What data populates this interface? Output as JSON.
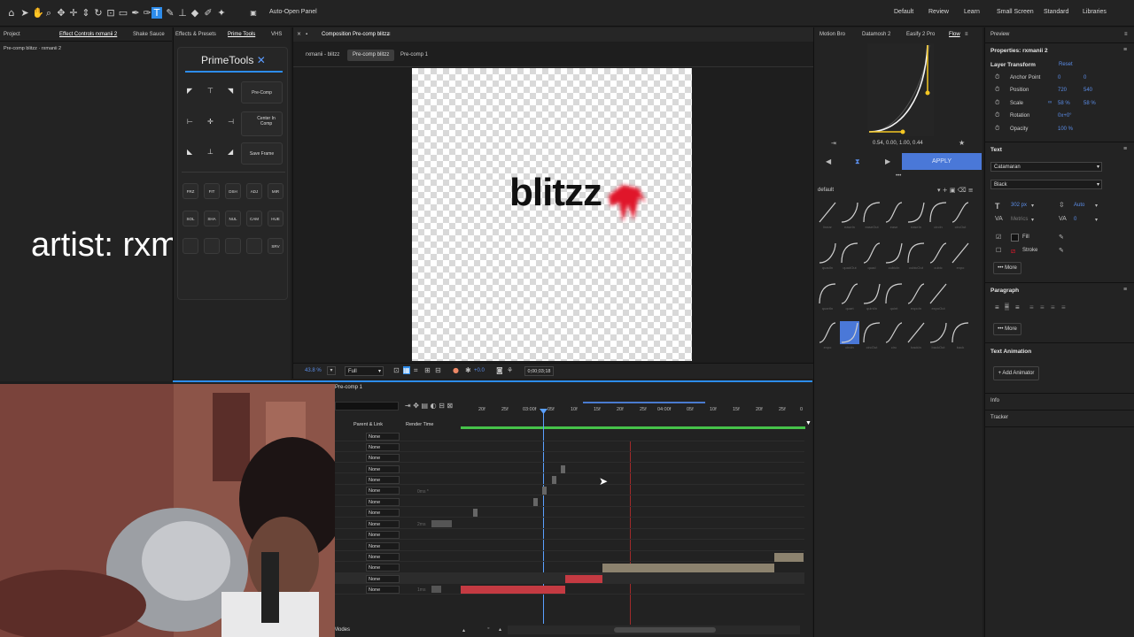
{
  "topbar": {
    "auto_open_panel": "Auto-Open Panel",
    "workspaces": [
      "Default",
      "Review",
      "Learn",
      "Small Screen",
      "Standard",
      "Libraries"
    ]
  },
  "left_panel": {
    "tabs": [
      "Project",
      "Effect Controls rxmanii 2"
    ],
    "subtitle": "Pre-comp blitzz · rxmanii 2",
    "overlay_text": "artist: rxmanii"
  },
  "primetools": {
    "tabs": [
      "Shake Sauce",
      "Effects & Presets",
      "Prime Tools",
      "VHS"
    ],
    "title": "PrimeTools",
    "buttons": [
      "Pre-Comp",
      "Center In Comp",
      "Save Frame"
    ],
    "small_row1": [
      "FRZ",
      "FIT",
      "DSH",
      "ADJ",
      "MIR"
    ],
    "small_row2": [
      "SOL",
      "SHA",
      "NUL",
      "CAM",
      "HUE"
    ],
    "small_row3": [
      "",
      "",
      "",
      "",
      "SRV"
    ]
  },
  "composition": {
    "tab_title": "Composition Pre-comp blitzz",
    "breadcrumbs": [
      "rxmanii - blitzz",
      "Pre-comp blitzz",
      "Pre-comp 1"
    ],
    "canvas_text": "blitzz",
    "zoom": "43.8 %",
    "resolution": "Full",
    "timecode": "0;00;03;18",
    "exposure": "+0.0"
  },
  "timeline": {
    "title": "Pre-comp 1",
    "col_parent": "Parent & Link",
    "col_render": "Render Time",
    "parent_value": "None",
    "ruler": [
      "20f",
      "25f",
      "03:00f",
      "05f",
      "10f",
      "15f",
      "20f",
      "25f",
      "04:00f",
      "05f",
      "10f",
      "15f",
      "20f",
      "25f",
      "0"
    ],
    "modes_label": "Modes",
    "render_labels": [
      "0ms *",
      "2ms",
      "1ms"
    ]
  },
  "flow": {
    "tabs": [
      "Motion Bro",
      "Datamosh 2",
      "Easify 2 Pro",
      "Flow"
    ],
    "curve_values": "0.54, 0.00, 1.00, 0.44",
    "apply_label": "APPLY",
    "preset_dropdown": "default",
    "ease_labels": [
      [
        "linear",
        "easeIn",
        "easeOut",
        "ease",
        "easeIn",
        "circIn",
        "circOut"
      ],
      [
        "quadIn",
        "quadOut",
        "quad",
        "cubicIn",
        "cubicOut",
        "cubic",
        "expo"
      ],
      [
        "quartIn",
        "quart",
        "quintIn",
        "quint",
        "expoIn",
        "expoOut"
      ],
      [
        "expo",
        "circIn",
        "circOut",
        "circ",
        "backIn",
        "backOut",
        "back"
      ]
    ]
  },
  "properties": {
    "preview_tab": "Preview",
    "title": "Properties: rxmanii 2",
    "layer_transform": "Layer Transform",
    "reset": "Reset",
    "anchor_label": "Anchor Point",
    "anchor_x": "0",
    "anchor_y": "0",
    "position_label": "Position",
    "position_x": "720",
    "position_y": "540",
    "scale_label": "Scale",
    "scale_x": "58 %",
    "scale_y": "58 %",
    "rotation_label": "Rotation",
    "rotation_val": "0x+0°",
    "opacity_label": "Opacity",
    "opacity_val": "100 %",
    "text_header": "Text",
    "font_family": "Catamaran",
    "font_style": "Black",
    "font_size": "302 px",
    "leading": "Auto",
    "kerning": "Metrics",
    "tracking": "0",
    "fill_label": "Fill",
    "stroke_label": "Stroke",
    "more_label": "More",
    "paragraph_header": "Paragraph",
    "text_animation_header": "Text Animation",
    "add_animator": "Add Animator",
    "info": "Info",
    "tracker": "Tracker"
  },
  "colors": {
    "accent": "#2d8ceb",
    "apply": "#4a78d8",
    "blitz_red": "#e0182b",
    "playhead": "#5aa0ff",
    "timeline_green": "#46c24a"
  }
}
